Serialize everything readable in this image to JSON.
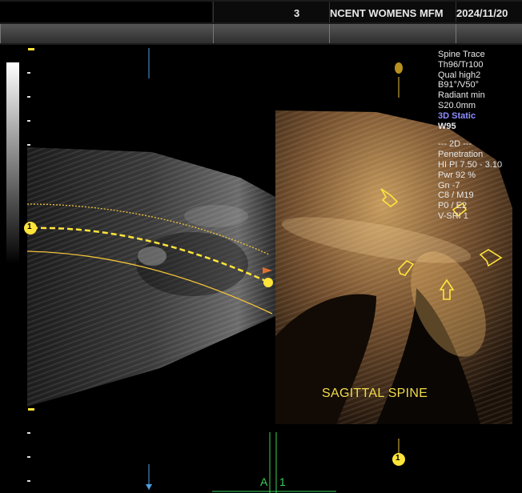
{
  "header": {
    "seg1_text": "3",
    "seg2_text": "NCENT WOMENS MFM",
    "seg3_text": "2024/11/20"
  },
  "info_panel": {
    "lines_a": [
      "Spine Trace",
      "Th96/Tr100",
      "Qual high2",
      "B91°/V50°",
      "Radiant min",
      "S20.0mm"
    ],
    "mode_3d": "3D Static",
    "window": "W95",
    "lines_b": [
      "--- 2D ---",
      "Penetration",
      "HI  PI 7.50 - 3.10",
      "Pwr  92 %",
      "Gn  -7",
      "C8 / M19",
      "P0 / E2",
      "V-SRI 1"
    ]
  },
  "view_label": "SAGITTAL SPINE",
  "markers": {
    "left_marker": "1",
    "bottom_marker": "1",
    "bottom_plane": "A",
    "bottom_index": "1"
  },
  "colors": {
    "marker_yellow": "#ffe43a",
    "trace_line": "#f2c23a",
    "plane_line": "#3ad05a",
    "label_yellow": "#f2dc4a",
    "mode_blue": "#8f8fff"
  }
}
